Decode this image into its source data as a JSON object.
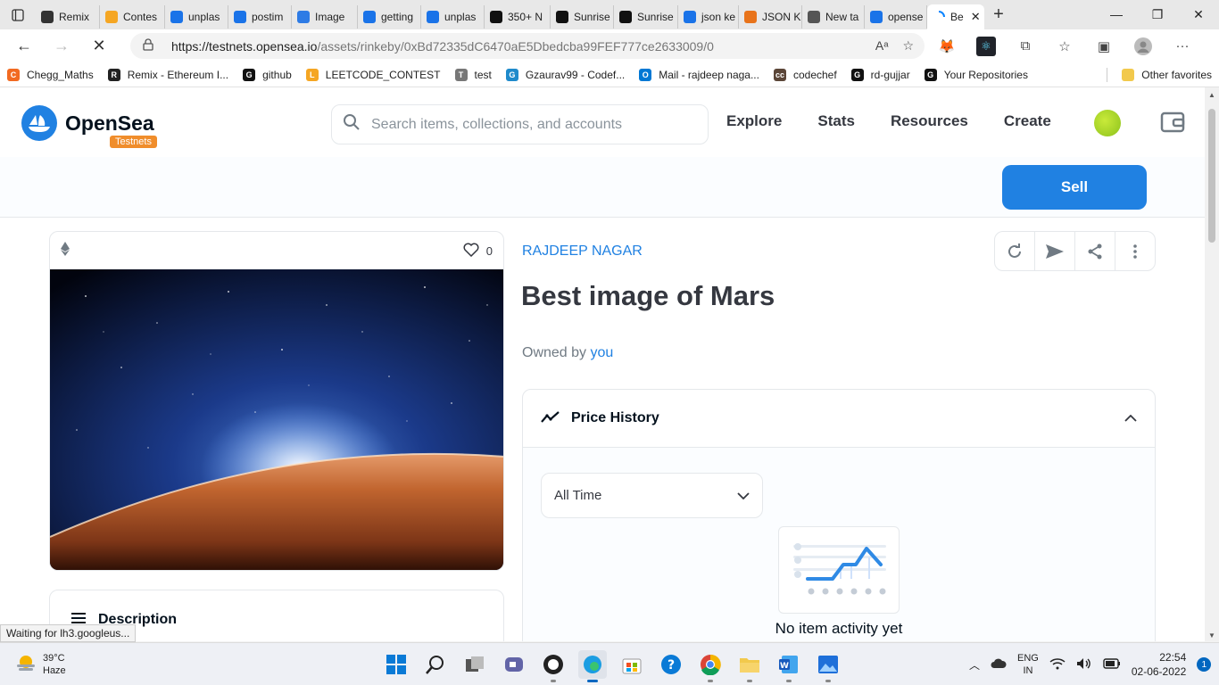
{
  "browser": {
    "tabs": [
      {
        "title": "Remix",
        "icon": "remix-icon",
        "color": "#333333"
      },
      {
        "title": "Contes",
        "icon": "codeforces-icon",
        "color": "#f5a623"
      },
      {
        "title": "unplas",
        "icon": "search-icon",
        "color": "#1a73e8"
      },
      {
        "title": "postim",
        "icon": "search-icon",
        "color": "#1a73e8"
      },
      {
        "title": "Image",
        "icon": "postimages-icon",
        "color": "#2d7be5"
      },
      {
        "title": "getting",
        "icon": "search-icon",
        "color": "#1a73e8"
      },
      {
        "title": "unplas",
        "icon": "search-icon",
        "color": "#1a73e8"
      },
      {
        "title": "350+ N",
        "icon": "unsplash-icon",
        "color": "#111111"
      },
      {
        "title": "Sunrise",
        "icon": "istock-icon",
        "color": "#111111"
      },
      {
        "title": "Sunrise",
        "icon": "istock-icon",
        "color": "#111111"
      },
      {
        "title": "json ke",
        "icon": "search-icon",
        "color": "#1a73e8"
      },
      {
        "title": "JSON K",
        "icon": "json-icon",
        "color": "#e8731a"
      },
      {
        "title": "New ta",
        "icon": "newtab-icon",
        "color": "#555555"
      },
      {
        "title": "opense",
        "icon": "search-icon",
        "color": "#1a73e8"
      }
    ],
    "active_tab": "Be",
    "url_host": "https://testnets.opensea.io",
    "url_path": "/assets/rinkeby/0xBd72335dC6470aE5Dbedcba99FEF777ce2633009/0",
    "bookmarks": [
      {
        "label": "Chegg_Maths",
        "color": "#f26a21",
        "glyph": "C"
      },
      {
        "label": "Remix - Ethereum I...",
        "color": "#222222",
        "glyph": "R"
      },
      {
        "label": "github",
        "color": "#111111",
        "glyph": "G"
      },
      {
        "label": "LEETCODE_CONTEST",
        "color": "#f5a623",
        "glyph": "L"
      },
      {
        "label": "test",
        "color": "#777777",
        "glyph": "T"
      },
      {
        "label": "Gzaurav99 - Codef...",
        "color": "#1f8acb",
        "glyph": "G"
      },
      {
        "label": "Mail - rajdeep naga...",
        "color": "#0078d4",
        "glyph": "O"
      },
      {
        "label": "codechef",
        "color": "#5b4638",
        "glyph": "cc"
      },
      {
        "label": "rd-gujjar",
        "color": "#111111",
        "glyph": "G"
      },
      {
        "label": "Your Repositories",
        "color": "#111111",
        "glyph": "G"
      }
    ],
    "other_favorites": "Other favorites",
    "status_text": "Waiting for lh3.googleus..."
  },
  "header": {
    "brand": "OpenSea",
    "badge": "Testnets",
    "search_placeholder": "Search items, collections, and accounts",
    "nav": [
      "Explore",
      "Stats",
      "Resources",
      "Create"
    ]
  },
  "sell_label": "Sell",
  "item": {
    "likes": "0",
    "collection": "RAJDEEP NAGAR",
    "title": "Best image of Mars",
    "owned_prefix": "Owned by",
    "owner": "you",
    "description_title": "Description"
  },
  "price_history": {
    "title": "Price History",
    "time_range": "All Time",
    "empty_text": "No item activity yet"
  },
  "taskbar": {
    "temp": "39°C",
    "weather": "Haze",
    "lang_top": "ENG",
    "lang_bottom": "IN",
    "time": "22:54",
    "date": "02-06-2022",
    "notifications": "1"
  },
  "colors": {
    "accent": "#2081e2",
    "testnets_badge": "#f08d2b"
  }
}
